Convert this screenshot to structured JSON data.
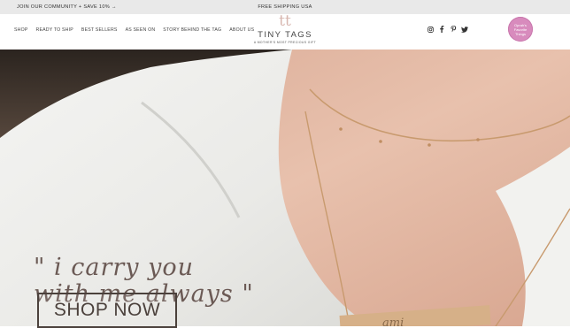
{
  "topbar": {
    "promo": "JOIN OUR COMMUNITY + SAVE 10% →",
    "shipping": "FREE SHIPPING USA"
  },
  "nav": {
    "items": [
      "SHOP",
      "READY TO SHIP",
      "BEST SELLERS",
      "AS SEEN ON",
      "STORY BEHIND THE TAG",
      "ABOUT US"
    ]
  },
  "logo": {
    "monogram": "tt",
    "name": "TINY TAGS",
    "tagline": "A MOTHER'S MOST PRECIOUS GIFT"
  },
  "social": {
    "icons": [
      "instagram-icon",
      "facebook-icon",
      "pinterest-icon",
      "twitter-icon"
    ]
  },
  "badge": {
    "line1": "Oprah's",
    "line2": "Favorite",
    "line3": "Things"
  },
  "hero": {
    "quote_line1": "\" i carry you",
    "quote_line2": "with me always \"",
    "cta_label": "SHOP NOW",
    "pendant_text": "ami"
  },
  "colors": {
    "topbar_bg": "#e9e9e9",
    "accent_pink": "#d88bbd",
    "text_brown": "#4b413c"
  }
}
